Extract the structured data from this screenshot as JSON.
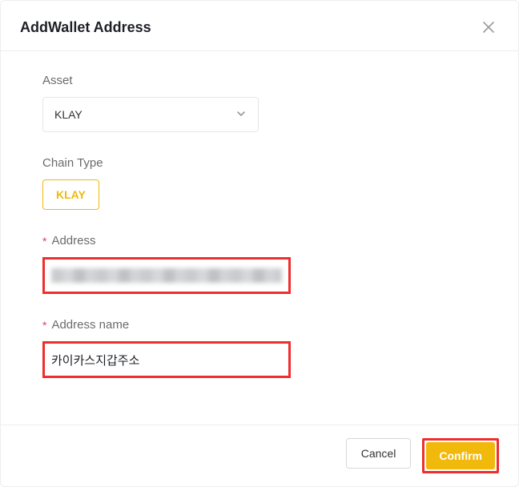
{
  "modal": {
    "title": "AddWallet Address"
  },
  "form": {
    "asset": {
      "label": "Asset",
      "value": "KLAY"
    },
    "chainType": {
      "label": "Chain Type",
      "value": "KLAY"
    },
    "address": {
      "label": "Address",
      "value": ""
    },
    "addressName": {
      "label": "Address name",
      "value": "카이카스지갑주소"
    }
  },
  "actions": {
    "cancel": "Cancel",
    "confirm": "Confirm"
  }
}
